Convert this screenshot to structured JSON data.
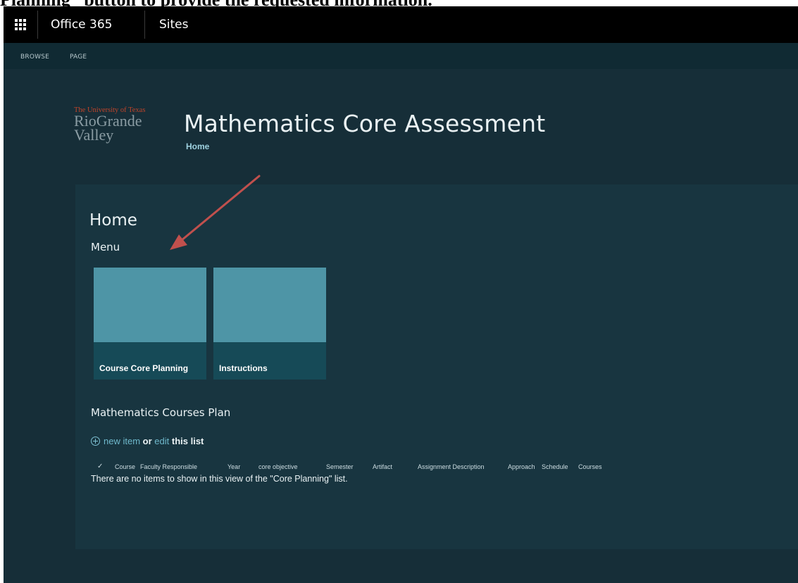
{
  "document": {
    "heading_bold": "Planning” button to provide the requested information."
  },
  "suite_bar": {
    "app_launcher_icon": "waffle-icon",
    "brand": "Office 365",
    "section": "Sites"
  },
  "ribbon": {
    "tabs": [
      "BROWSE",
      "PAGE"
    ]
  },
  "site": {
    "logo": {
      "line1": "The University of Texas",
      "line2": "RioGrande",
      "line3": "Valley"
    },
    "title": "Mathematics Core Assessment",
    "breadcrumb": "Home"
  },
  "page": {
    "title": "Home",
    "menu_title": "Menu",
    "tiles": [
      {
        "label": "Course Core Planning"
      },
      {
        "label": "Instructions"
      }
    ],
    "list": {
      "title": "Mathematics Courses Plan",
      "new_item_label": "new item",
      "or_text": "or",
      "edit_label": "edit",
      "this_list_text": "this list",
      "columns": [
        "Course",
        "Faculty Responsible",
        "Year",
        "core objective",
        "Semester",
        "Artifact",
        "Assignment Description",
        "Approach",
        "Schedule",
        "Courses"
      ],
      "empty_message": "There are no items to show in this view of the \"Core Planning\" list."
    }
  },
  "annotation": {
    "arrow_color": "#c0504d"
  }
}
